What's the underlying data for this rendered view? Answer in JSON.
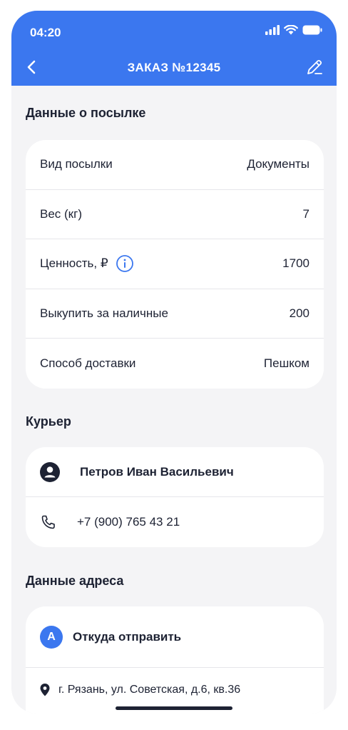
{
  "status_bar": {
    "time": "04:20"
  },
  "nav": {
    "title": "ЗАКАЗ №12345"
  },
  "parcel": {
    "section_title": "Данные о посылке",
    "rows": [
      {
        "label": "Вид посылки",
        "value": "Документы"
      },
      {
        "label": "Вес (кг)",
        "value": "7"
      },
      {
        "label": "Ценность, ₽",
        "value": "1700"
      },
      {
        "label": "Выкупить за наличные",
        "value": "200"
      },
      {
        "label": "Способ доставки",
        "value": "Пешком"
      }
    ]
  },
  "courier": {
    "section_title": "Курьер",
    "name": "Петров Иван Васильевич",
    "phone": "+7 (900) 765 43 21"
  },
  "address": {
    "section_title": "Данные адреса",
    "badge": "A",
    "from_title": "Откуда отправить",
    "from_address": "г. Рязань, ул. Советская, д.6, кв.36"
  },
  "colors": {
    "accent": "#3b77ef",
    "text": "#1d2233",
    "background": "#f4f4f6"
  }
}
